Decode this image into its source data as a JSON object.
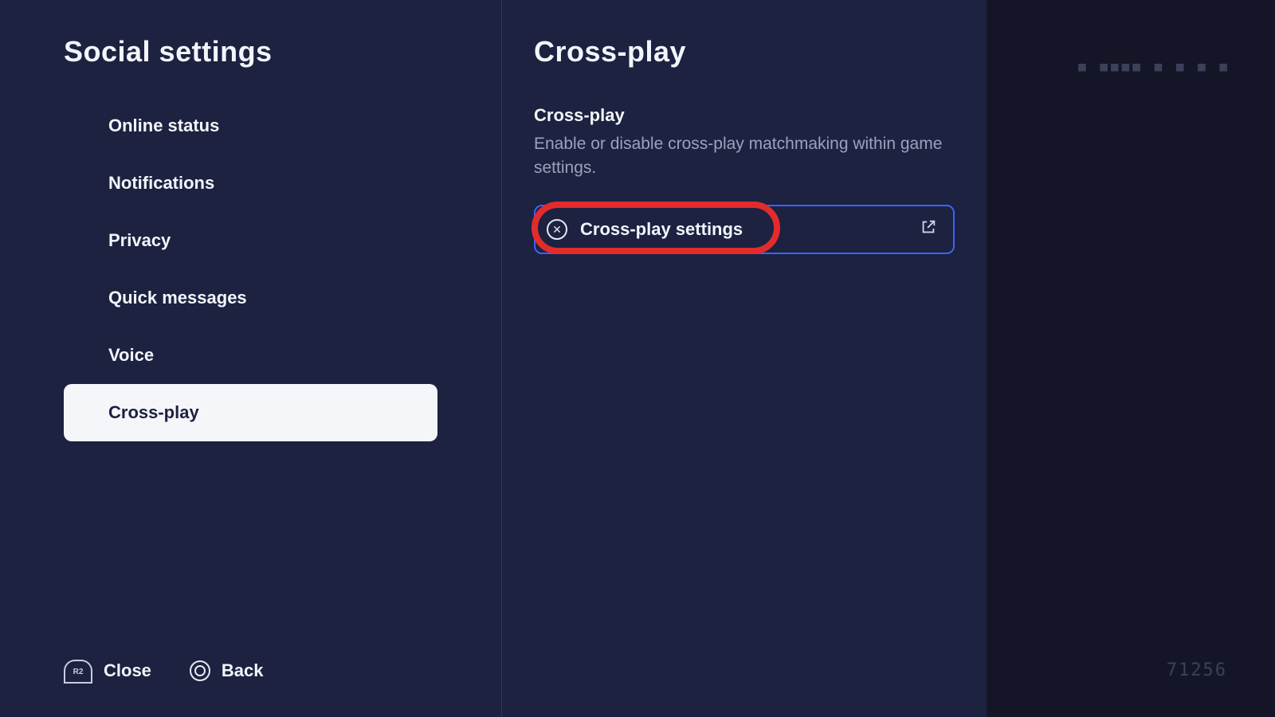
{
  "sidebar": {
    "title": "Social settings",
    "items": [
      {
        "label": "Online status"
      },
      {
        "label": "Notifications"
      },
      {
        "label": "Privacy"
      },
      {
        "label": "Quick messages"
      },
      {
        "label": "Voice"
      },
      {
        "label": "Cross-play"
      }
    ]
  },
  "footer": {
    "close_hint": "R2",
    "close_label": "Close",
    "back_label": "Back"
  },
  "content": {
    "title": "Cross-play",
    "section_heading": "Cross-play",
    "section_description": "Enable or disable cross-play matchmaking within game settings.",
    "action_label": "Cross-play settings"
  },
  "hud": {
    "top": "■ ■■■■ ■ ■  ■ ■",
    "bottom": "71256"
  }
}
